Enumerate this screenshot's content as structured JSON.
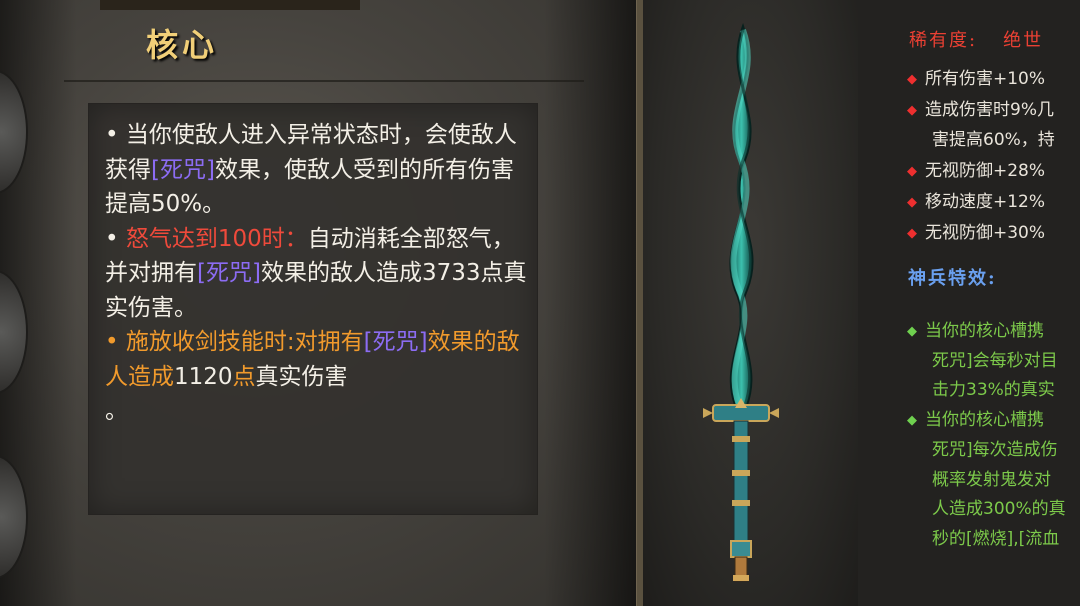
{
  "core": {
    "title": "核心",
    "p1_a": "• 当你使敌人进入异常状态时，会使敌人获得",
    "p1_tag": "[死咒]",
    "p1_b": "效果，使敌人受到的所有伤害提高50%。",
    "p2_bullet": "•",
    "p2_red": "怒气达到100时：",
    "p2_a": "自动消耗全部怒气，并对拥有",
    "p2_tag": "[死咒]",
    "p2_b": "效果的敌人造成3733点真实伤害。",
    "p3_orange": "• 施放收剑技能时:对拥有",
    "p3_tag": "[死咒]",
    "p3_orange2": "效果的敌人造成",
    "p3_num": "1120",
    "p3_orange3": "点",
    "p3_c": "真实伤害",
    "p3_end": "。"
  },
  "item": {
    "rarity_label": "稀有度:",
    "rarity_value": "绝世",
    "stats": [
      "所有伤害+10%",
      "造成伤害时9%几",
      "无视防御+28%",
      "移动速度+12%",
      "无视防御+30%"
    ],
    "stat_cont": "害提高60%，持",
    "special_title": "神兵特效:",
    "effects": [
      "当你的核心槽携",
      "当你的核心槽携"
    ],
    "effect1_lines": [
      "死咒]会每秒对目",
      "击力33%的真实"
    ],
    "effect2_lines": [
      "死咒]每次造成伤",
      "概率发射鬼发对",
      "人造成300%的真",
      "秒的[燃烧],[流血"
    ]
  },
  "colors": {
    "title_gold": "#f1cf78",
    "anger_red": "#ef4a3b",
    "curse_purple": "#8c6cf3",
    "skill_orange": "#f19a2c",
    "rarity_red": "#ea4033",
    "special_blue": "#6aa0ef",
    "effect_green": "#7cc94a"
  }
}
